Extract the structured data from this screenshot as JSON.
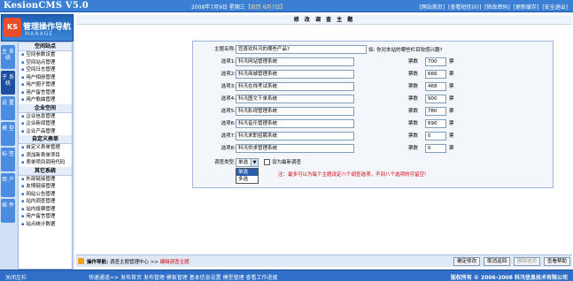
{
  "header": {
    "app_title": "KesionCMS V5.0",
    "date": "2008年7月9日 星期三",
    "lunar": "【农历 6月7日】",
    "links": [
      "[网站首页]",
      "[查看短信(0)]",
      "[修改密码]",
      "[更新缓存]",
      "[安全退出]"
    ]
  },
  "logo": {
    "mark": "KS",
    "title": "管理操作导航",
    "subtitle": "MANAGE"
  },
  "side_tabs": [
    {
      "label": "主 系 统",
      "active": false
    },
    {
      "label": "子 系 统",
      "active": true
    },
    {
      "label": "设 置",
      "active": false
    },
    {
      "label": "模 型",
      "active": false
    },
    {
      "label": "标 签",
      "active": false
    },
    {
      "label": "用 户",
      "active": false
    },
    {
      "label": "插 件",
      "active": false
    }
  ],
  "menu": {
    "sections": [
      {
        "title": "空间站点",
        "items": [
          "空间参数设置",
          "空间站点管理",
          "空间日志管理",
          "用户相册管理",
          "用户圈子管理",
          "用户留言管理",
          "用户歌曲管理"
        ]
      },
      {
        "title": "企业空间",
        "items": [
          "企业信息管理",
          "企业新闻管理",
          "企业产品管理"
        ]
      },
      {
        "title": "自定义表单",
        "items": [
          "自定义表单管理",
          "添加新表单项目",
          "表单项目调用代码"
        ]
      },
      {
        "title": "其它系统",
        "items": [
          "外部链接管理",
          "友情链接管理",
          "网站公告管理",
          "站内调查管理",
          "站内投票管理",
          "用户留言管理",
          "站点统计数据"
        ]
      }
    ]
  },
  "main": {
    "title": "修 改 调 查 主 题",
    "subject_label": "主题名称:",
    "subject_value": "您喜欢科汛的哪些产品?",
    "subject_hint": "如: 你对本站的哪些栏目较感兴趣?",
    "options": [
      {
        "label": "选项1:",
        "value": "科汛网站管理系统",
        "votes": "700"
      },
      {
        "label": "选项2:",
        "value": "科汛商城管理系统",
        "votes": "666"
      },
      {
        "label": "选项3:",
        "value": "科汛在线考试系统",
        "votes": "468"
      },
      {
        "label": "选项4:",
        "value": "科汛图文下单系统",
        "votes": "900"
      },
      {
        "label": "选项5:",
        "value": "科汛影视管理系统",
        "votes": "780"
      },
      {
        "label": "选项6:",
        "value": "科汛音乐管理系统",
        "votes": "690"
      },
      {
        "label": "选项7:",
        "value": "科汛求职招聘系统",
        "votes": "0"
      },
      {
        "label": "选项8:",
        "value": "科汛供求管理系统",
        "votes": "0"
      }
    ],
    "votes_label": "票数",
    "votes_unit": "票",
    "type_label": "调查类型:",
    "type_value": "单选",
    "type_options": [
      "单选",
      "多选"
    ],
    "latest_label": "设为最新调查",
    "note": "注：最多可以为每个主题设定八个调查选项，不到八个选项的可留空!"
  },
  "nav": {
    "label": "操作导航:",
    "path": "调查主题管理中心 >>",
    "current": "编辑调查主题",
    "buttons": [
      {
        "label": "确定修改",
        "disabled": false
      },
      {
        "label": "取消返回",
        "disabled": false
      },
      {
        "label": "删除选项",
        "disabled": true
      },
      {
        "label": "查看帮助",
        "disabled": false
      }
    ]
  },
  "footer": {
    "left": "关闭左栏",
    "links": "快速通道=> 发布首页  发布管理  模板管理  基本信息设置  模型管理  查看工作进度",
    "right": "版权所有 © 2006-2008 科汛信息技术有限公司"
  }
}
